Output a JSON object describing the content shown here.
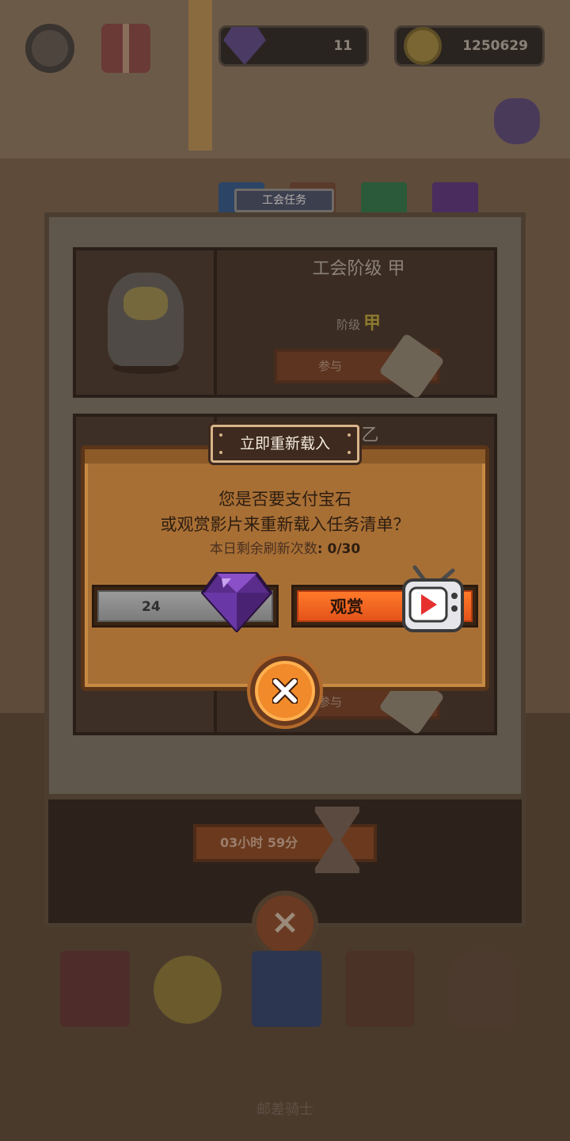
{
  "hud": {
    "gems": "11",
    "coins": "1250629"
  },
  "board": {
    "tab_label": "工会任务",
    "quests": [
      {
        "title": "工会阶级 甲",
        "rank_label": "阶级",
        "rank_mark": "甲",
        "join_label": "参与"
      },
      {
        "title": "级 乙",
        "join_label": "参与"
      }
    ],
    "timer": "03小时 59分"
  },
  "dialog": {
    "title": "立即重新载入",
    "line1": "您是否要支付宝石",
    "line2": "或观赏影片来重新载入任务清单？",
    "refresh_label": "本日剩余刷新次数",
    "refresh_count": ": 0/30",
    "gem_cost": "24",
    "watch_label": "观赏"
  },
  "footer": {
    "text": "邮差骑士"
  },
  "colors": {
    "accent_orange": "#f06a22",
    "gem_purple": "#7a3cc0",
    "dialog_wood": "#a86f35"
  },
  "icons": {
    "settings": "gear-icon",
    "gift": "gift-icon",
    "gem": "gem-icon",
    "coin": "coin-icon",
    "bag": "bag-icon",
    "hourglass": "hourglass-icon",
    "tv": "tv-icon",
    "close": "close-icon"
  }
}
